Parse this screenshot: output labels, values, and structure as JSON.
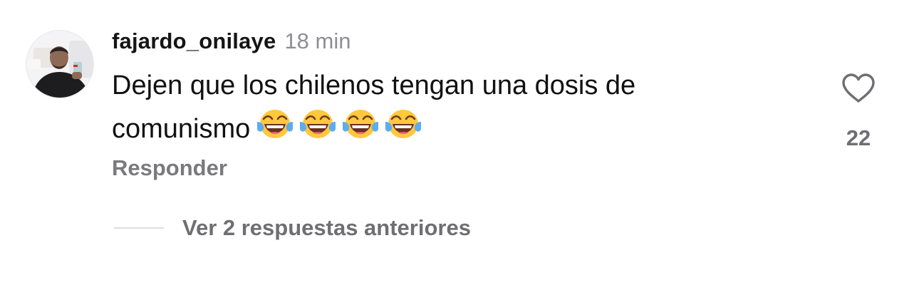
{
  "comment": {
    "username": "fajardo_onilaye",
    "time": "18 min",
    "text": "Dejen que los chilenos tengan una dosis de comunismo",
    "emojis": [
      "face-with-tears-of-joy",
      "face-with-tears-of-joy",
      "face-with-tears-of-joy",
      "face-with-tears-of-joy"
    ],
    "reply_label": "Responder",
    "like_icon": "heart-outline-icon",
    "like_count": "22"
  },
  "replies": {
    "view_label": "Ver 2 respuestas anteriores"
  },
  "colors": {
    "username": "#151515",
    "secondary_text": "#8e8e93",
    "action_text": "#6e6e73",
    "divider": "#dcdcdc",
    "emoji_face": "#FFC83D",
    "emoji_tears": "#5DADEC"
  }
}
